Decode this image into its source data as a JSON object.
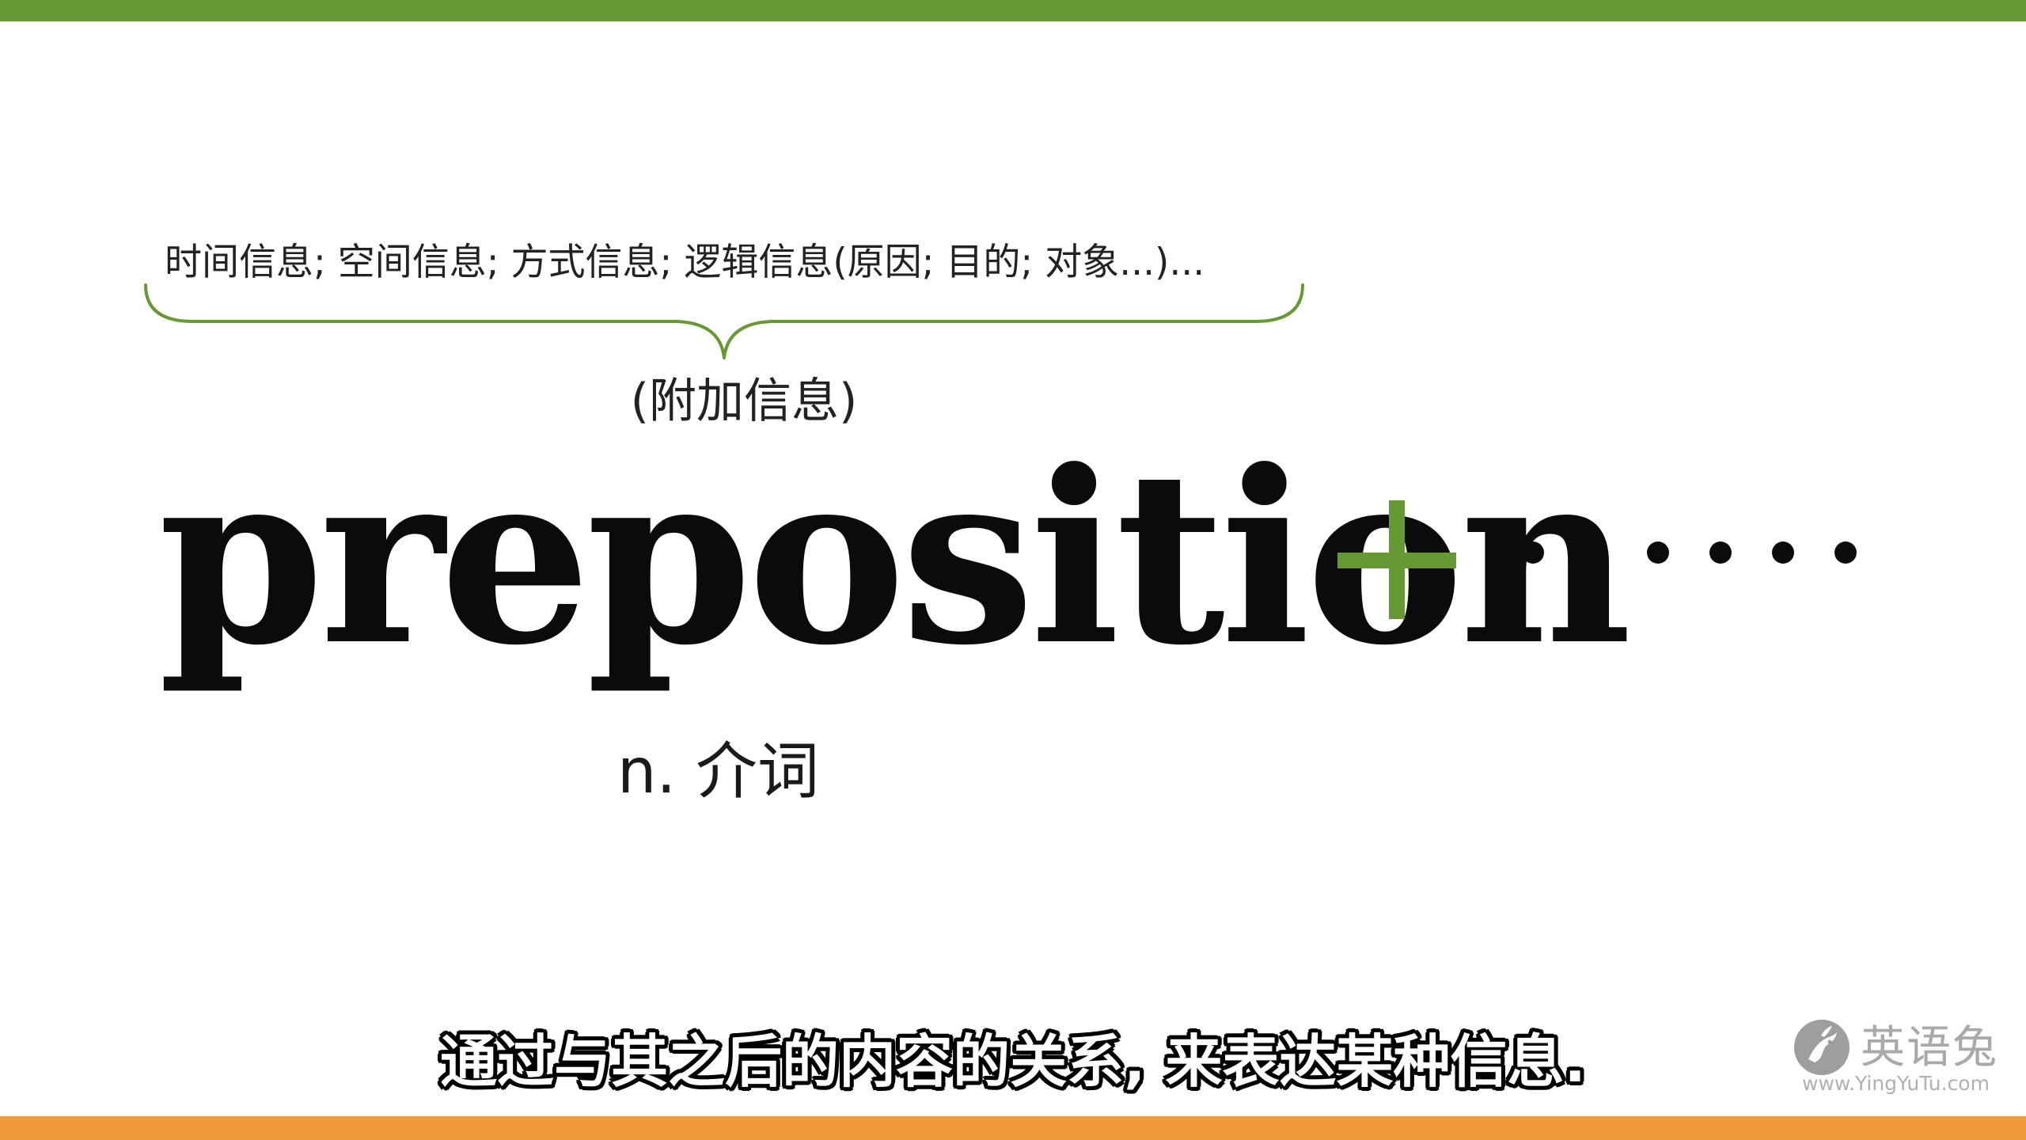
{
  "slide": {
    "info_line": "时间信息; 空间信息; 方式信息; 逻辑信息(原因; 目的; 对象...)...",
    "extra_info": "(附加信息)",
    "headword": "preposition",
    "plus_symbol": "+",
    "ellipsis": "······",
    "part_of_speech": "n. 介词"
  },
  "subtitle": "通过与其之后的内容的关系, 来表达某种信息.",
  "watermark": {
    "name": "英语兔",
    "url": "www.YingYuTu.com",
    "logo_icon": "rabbit-logo-icon"
  },
  "colors": {
    "top_bar": "#669933",
    "bottom_bar": "#ef9a3a",
    "accent_green": "#669933",
    "text": "#0b0b0b"
  }
}
